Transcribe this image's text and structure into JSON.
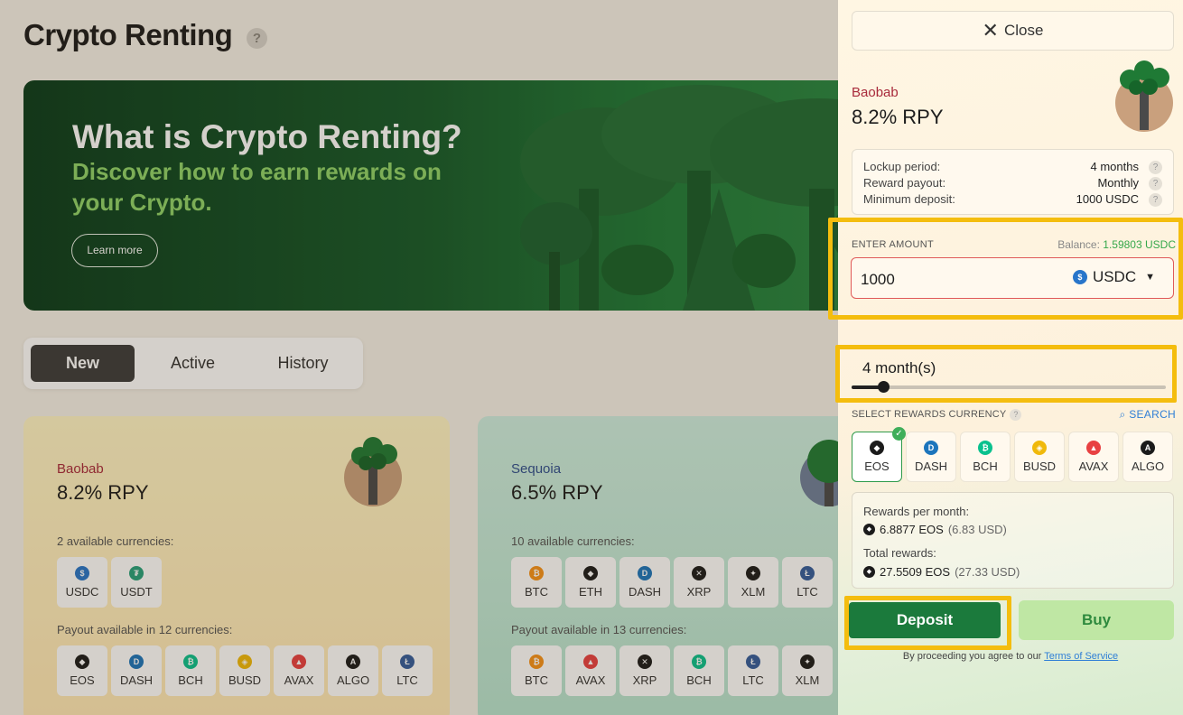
{
  "page": {
    "title": "Crypto Renting",
    "help_icon": "?"
  },
  "hero": {
    "title": "What is Crypto Renting?",
    "subtitle": "Discover how to earn rewards on your Crypto.",
    "button": "Learn more"
  },
  "tabs": [
    {
      "label": "New",
      "active": true
    },
    {
      "label": "Active",
      "active": false
    },
    {
      "label": "History",
      "active": false
    }
  ],
  "cards": [
    {
      "name": "Baobab",
      "rate": "8.2% RPY",
      "currencies_label": "2 available currencies:",
      "currencies": [
        "USDC",
        "USDT"
      ],
      "payout_label": "Payout available in 12 currencies:",
      "payout": [
        "EOS",
        "DASH",
        "BCH",
        "BUSD",
        "AVAX",
        "ALGO",
        "LTC"
      ]
    },
    {
      "name": "Sequoia",
      "rate": "6.5% RPY",
      "currencies_label": "10 available currencies:",
      "currencies": [
        "BTC",
        "ETH",
        "DASH",
        "XRP",
        "XLM",
        "LTC"
      ],
      "payout_label": "Payout available in 13 currencies:",
      "payout": [
        "BTC",
        "AVAX",
        "XRP",
        "BCH",
        "LTC",
        "XLM"
      ]
    }
  ],
  "panel": {
    "close": "Close",
    "plan_name": "Baobab",
    "plan_rate": "8.2% RPY",
    "info": [
      {
        "label": "Lockup period:",
        "value": "4 months"
      },
      {
        "label": "Reward payout:",
        "value": "Monthly"
      },
      {
        "label": "Minimum deposit:",
        "value": "1000 USDC"
      }
    ],
    "enter_amount_label": "ENTER AMOUNT",
    "balance_label": "Balance:",
    "balance_value": "1.59803 USDC",
    "amount_value": "1000",
    "amount_currency": "USDC",
    "months_label": "4 month(s)",
    "slider_fraction": 0.1,
    "rewards_currency_label": "SELECT REWARDS CURRENCY",
    "search_label": "SEARCH",
    "reward_currencies": [
      {
        "code": "EOS",
        "selected": true
      },
      {
        "code": "DASH",
        "selected": false
      },
      {
        "code": "BCH",
        "selected": false
      },
      {
        "code": "BUSD",
        "selected": false
      },
      {
        "code": "AVAX",
        "selected": false
      },
      {
        "code": "ALGO",
        "selected": false
      }
    ],
    "rewards_per_month_label": "Rewards per month:",
    "rewards_per_month_value": "6.8877 EOS",
    "rewards_per_month_usd": "(6.83 USD)",
    "total_rewards_label": "Total rewards:",
    "total_rewards_value": "27.5509 EOS",
    "total_rewards_usd": "(27.33 USD)",
    "deposit_button": "Deposit",
    "buy_button": "Buy",
    "terms_prefix": "By proceeding you agree to our",
    "terms_link": "Terms of Service"
  },
  "colors": {
    "accent_green": "#1b7a3c",
    "highlight": "#f4bd0e",
    "error_red": "#e05a5a",
    "link_blue": "#2f7fd6"
  },
  "coin_colors": {
    "USDC": "#2775ca",
    "USDT": "#26a17b",
    "EOS": "#1b1b1b",
    "DASH": "#1c75bc",
    "BCH": "#0ac18e",
    "BUSD": "#f0b90b",
    "AVAX": "#e84142",
    "ALGO": "#1b1b1b",
    "LTC": "#345d9d",
    "BTC": "#f7931a",
    "ETH": "#1b1b1b",
    "XRP": "#1b1b1b",
    "XLM": "#1b1b1b"
  },
  "coin_glyphs": {
    "USDC": "$",
    "USDT": "₮",
    "EOS": "◆",
    "DASH": "D",
    "BCH": "₿",
    "BUSD": "◈",
    "AVAX": "▲",
    "ALGO": "A",
    "LTC": "Ł",
    "BTC": "₿",
    "ETH": "◆",
    "XRP": "✕",
    "XLM": "✦"
  }
}
